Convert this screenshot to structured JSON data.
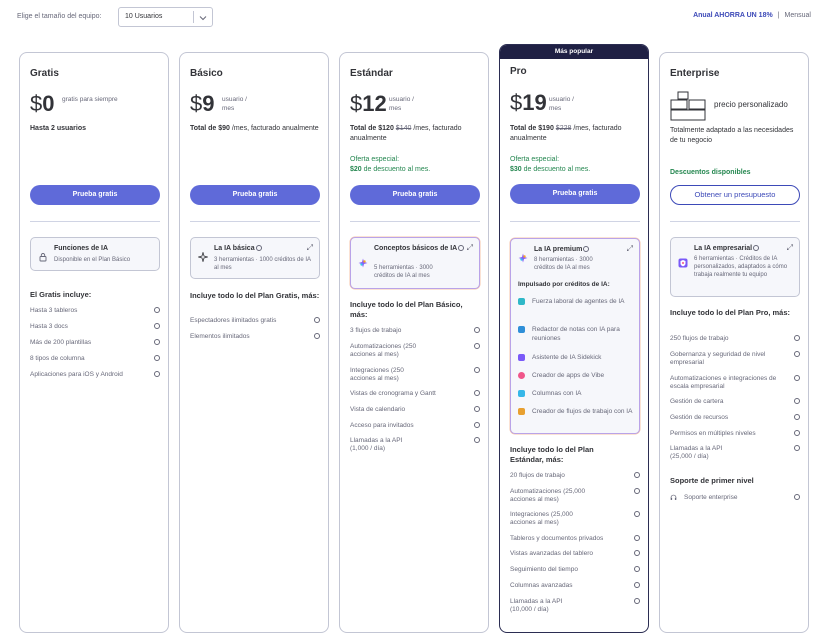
{
  "header": {
    "team_label": "Elige el tamaño del equipo:",
    "team_value": "10 Usuarios",
    "annual_label": "Anual AHORRA UN 18%",
    "separator": "|",
    "monthly_label": "Mensual"
  },
  "colors": {
    "primary_button": "#5f6ad9",
    "accent_text": "#3d4ab8",
    "offer_green": "#258750",
    "popular_banner": "#1f2044"
  },
  "plans": {
    "gratis": {
      "name": "Gratis",
      "currency": "$",
      "price": "0",
      "price_note": "gratis para siempre",
      "total": "Hasta 2 usuarios",
      "cta": "Prueba gratis",
      "ai_title": "Funciones de IA",
      "ai_desc": "Disponible en el Plan Básico",
      "ai_icon": "lock-icon",
      "includes_title": "El Gratis incluye:",
      "features": [
        "Hasta 3 tableros",
        "Hasta 3 docs",
        "Más de 200 plantillas",
        "8 tipos de columna",
        "Aplicaciones para iOS y Android"
      ]
    },
    "basico": {
      "name": "Básico",
      "currency": "$",
      "price": "9",
      "price_note": "usuario / mes",
      "total_strong": "Total de $90",
      "total_rest": " /mes, facturado anualmente",
      "cta": "Prueba gratis",
      "ai_title": "La IA básica",
      "ai_desc": "3 herramientas · 1000 créditos de IA al mes",
      "ai_icon": "sparkle-outline-icon",
      "includes_title": "Incluye todo lo del Plan Gratis, más:",
      "features": [
        "Espectadores ilimitados gratis",
        "Elementos ilimitados"
      ]
    },
    "estandar": {
      "name": "Estándar",
      "currency": "$",
      "price": "12",
      "price_note": "usuario / mes",
      "total_strong": "Total de $120",
      "total_old": "$140",
      "total_rest": " /mes, facturado anualmente",
      "offer_label": "Oferta especial:",
      "offer_strong": "$20",
      "offer_rest": " de descuento al mes.",
      "cta": "Prueba gratis",
      "ai_title": "Conceptos básicos de IA",
      "ai_desc": "5 herramientas · 3000 créditos de IA al mes",
      "ai_icon": "sparkle-color-icon",
      "includes_title": "Incluye todo lo del Plan Básico, más:",
      "features": [
        "3 flujos de trabajo",
        "Automatizaciones (250 acciones al mes)",
        "Integraciones (250 acciones al mes)",
        "Vistas de cronograma y Gantt",
        "Vista de calendario",
        "Acceso para invitados",
        "Llamadas a la API (1,000 / día)"
      ]
    },
    "pro": {
      "banner": "Más popular",
      "name": "Pro",
      "currency": "$",
      "price": "19",
      "price_note": "usuario / mes",
      "total_strong": "Total de $190",
      "total_old": "$228",
      "total_rest": " /mes, facturado anualmente",
      "offer_label": "Oferta especial:",
      "offer_strong": "$30",
      "offer_rest": " de descuento al mes.",
      "cta": "Prueba gratis",
      "ai_title": "La IA premium",
      "ai_desc": "8 herramientas · 3000 créditos de IA al mes",
      "ai_icon": "sparkle-color-icon",
      "ai_sub": "Impulsado por créditos de IA:",
      "ai_items": [
        {
          "label": "Fuerza laboral de agentes de IA",
          "icon": "agent-icon",
          "color": "#2fb8c8"
        },
        {
          "label": "Redactor de notas con IA para reuniones",
          "icon": "notetaker-icon",
          "color": "#2f8fd8"
        },
        {
          "label": "Asistente de IA Sidekick",
          "icon": "sidekick-icon",
          "color": "#7a5af8"
        },
        {
          "label": "Creador de apps de Vibe",
          "icon": "vibe-heart-icon",
          "color": "#f0568a"
        },
        {
          "label": "Columnas con IA",
          "icon": "columns-ai-icon",
          "color": "#36b7e8"
        },
        {
          "label": "Creador de flujos de trabajo con IA",
          "icon": "workflow-ai-icon",
          "color": "#e8a030"
        }
      ],
      "includes_title": "Incluye todo lo del Plan Estándar, más:",
      "features": [
        "20 flujos de trabajo",
        "Automatizaciones (25,000 acciones al mes)",
        "Integraciones (25,000 acciones al mes)",
        "Tableros y documentos privados",
        "Vistas avanzadas del tablero",
        "Seguimiento del tiempo",
        "Columnas avanzadas",
        "Llamadas a la API (10,000 / día)"
      ]
    },
    "enterprise": {
      "name": "Enterprise",
      "custom_price": "precio personalizado",
      "desc": "Totalmente adaptado a las necesidades de tu negocio",
      "discount": "Descuentos disponibles",
      "cta": "Obtener un presupuesto",
      "ai_title": "La IA empresarial",
      "ai_desc": "6 herramientas · Créditos de IA personalizados, adaptados a cómo trabaja realmente tu equipo",
      "ai_icon": "shield-ai-icon",
      "includes_title": "Incluye todo lo del Plan Pro, más:",
      "features": [
        "250 flujos de trabajo",
        "Gobernanza y seguridad de nivel empresarial",
        "Automatizaciones e integraciones de escala empresarial",
        "Gestión de cartera",
        "Gestión de recursos",
        "Permisos en múltiples niveles",
        "Llamadas a la API (25,000 / día)"
      ],
      "support_title": "Soporte de primer nivel",
      "support_items": [
        "Soporte enterprise"
      ]
    }
  }
}
